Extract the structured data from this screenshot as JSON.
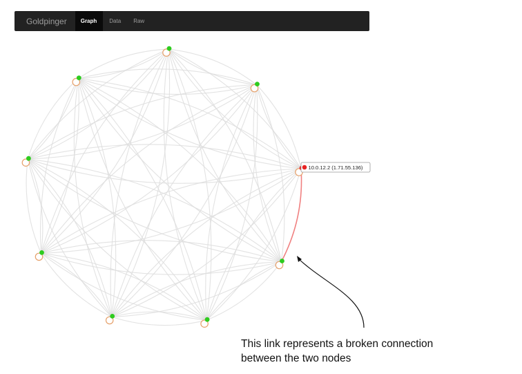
{
  "navbar": {
    "brand": "Goldpinger",
    "tabs": [
      {
        "label": "Graph",
        "active": true
      },
      {
        "label": "Data",
        "active": false
      },
      {
        "label": "Raw",
        "active": false
      }
    ]
  },
  "graph": {
    "node_count": 9,
    "node_status": [
      "ok",
      "ok",
      "broken",
      "ok",
      "ok",
      "ok",
      "ok",
      "ok",
      "ok"
    ],
    "broken_link": {
      "from": 2,
      "to": 3
    },
    "tooltip": {
      "node": 2,
      "text": "10.0.12.2 (1.71.55.136)"
    }
  },
  "annotation": {
    "line1": "This link represents a broken connection",
    "line2": "between the two nodes"
  },
  "colors": {
    "ok": "#2ecc1f",
    "broken": "#e82424",
    "link": "#dddddd",
    "broken_link": "#f08080",
    "host_ring": "#e6a06a"
  }
}
